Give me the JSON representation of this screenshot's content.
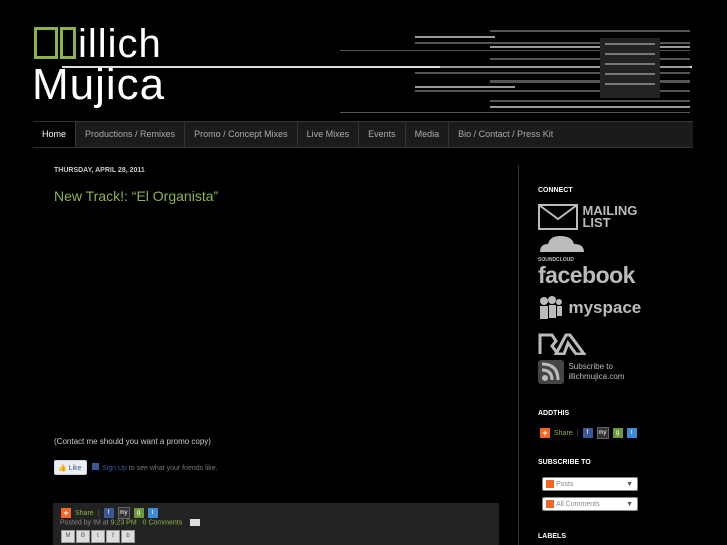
{
  "header": {
    "logo_line1": "illich",
    "logo_line2": "Mujica"
  },
  "nav": {
    "items": [
      "Home",
      "Productions / Remixes",
      "Promo / Concept Mixes",
      "Live Mixes",
      "Events",
      "Media",
      "Bio / Contact / Press Kit"
    ]
  },
  "post": {
    "date": "THURSDAY, APRIL 28, 2011",
    "title": "New Track!: “El Organista”",
    "promo_text": "(Contact me should you want a promo copy)",
    "like_label": "Like",
    "signup_link": "Sign Up",
    "signup_text": " to see what your friends like.",
    "share_label": "Share",
    "posted_by": "Posted by IM at",
    "time": "9:23 PM",
    "comments": "0 Comments"
  },
  "sidebar": {
    "connect_heading": "CONNECT",
    "mailing_list": "MAILING LIST",
    "soundcloud": "SOUNDCLOUD",
    "facebook": "facebook",
    "myspace": "myspace",
    "ra": "RA",
    "subscribe_text": "Subscribe to illichmujica.com",
    "addthis_heading": "ADDTHIS",
    "share_label": "Share",
    "subscribe_heading": "SUBSCRIBE TO",
    "posts_option": "Posts",
    "comments_option": "All Comments",
    "labels_heading": "LABELS"
  },
  "colors": {
    "accent": "#8db34a",
    "background": "#000000"
  }
}
